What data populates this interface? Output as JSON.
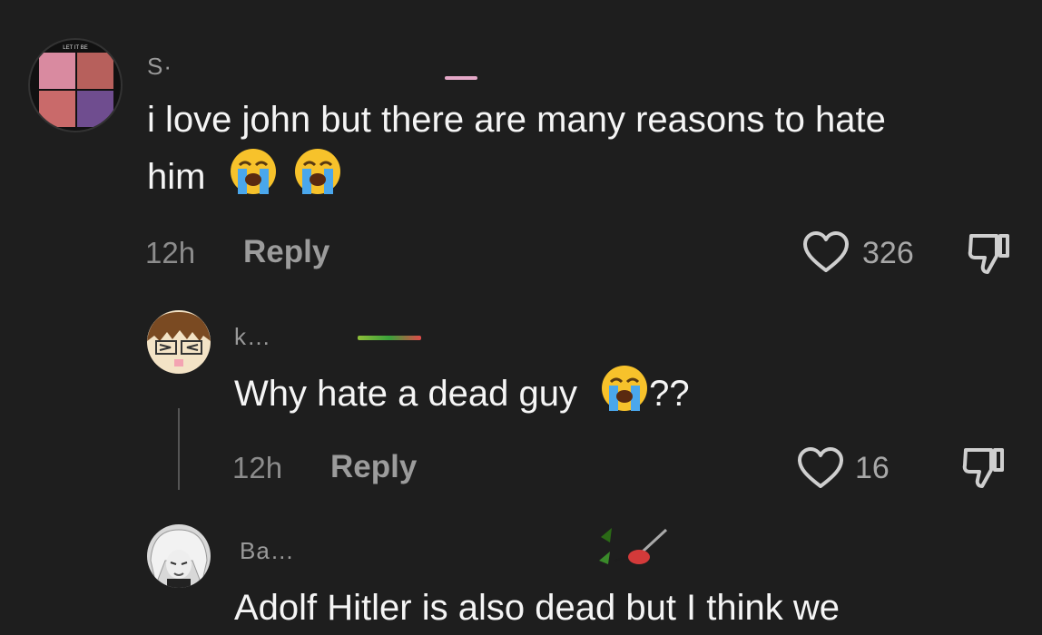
{
  "comments": [
    {
      "username": "S·",
      "text_line1": "i love john but there are many reasons to hate",
      "text_line2": "him",
      "time": "12h",
      "reply_label": "Reply",
      "likes": "326",
      "avatar_caption": "LET IT BE"
    },
    {
      "username": "k…",
      "text": "Why hate a dead guy",
      "text_suffix": "??",
      "time": "12h",
      "reply_label": "Reply",
      "likes": "16"
    },
    {
      "username": "Ba…",
      "text": "Adolf Hitler is also dead but I think we"
    }
  ],
  "icons": {
    "like": "heart-outline-icon",
    "dislike": "thumbs-down-icon",
    "emoji": "loudly-crying-face-emoji"
  },
  "colors": {
    "background": "#1e1e1e",
    "text": "#f5f5f5",
    "meta": "#8c8c8c"
  }
}
